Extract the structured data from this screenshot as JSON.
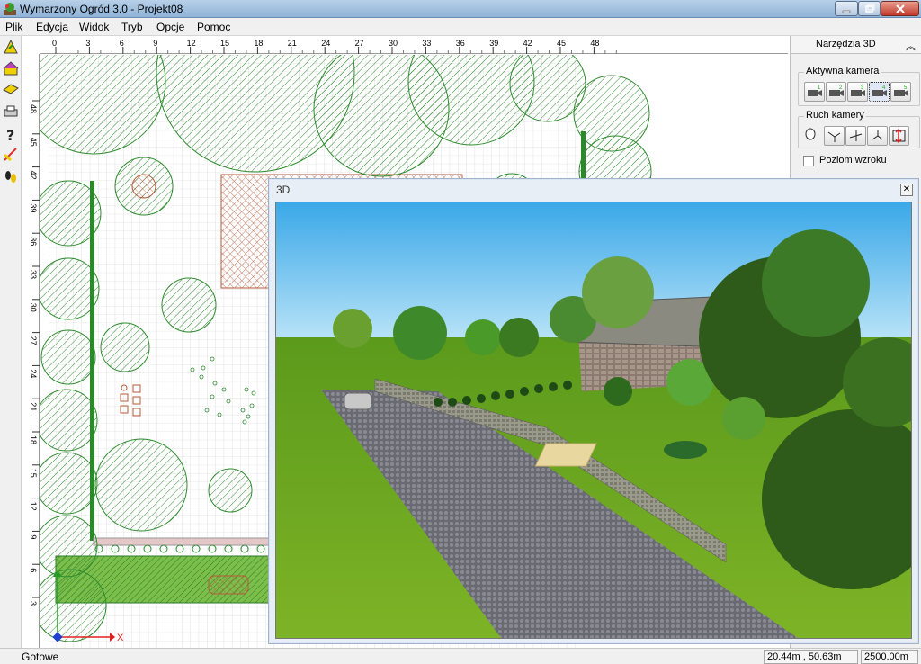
{
  "window": {
    "title": "Wymarzony Ogród 3.0 - Projekt08"
  },
  "menu": [
    "Plik",
    "Edycja",
    "Widok",
    "Tryb",
    "Opcje",
    "Pomoc"
  ],
  "ruler": {
    "top_ticks": [
      "0",
      "3",
      "6",
      "9",
      "12",
      "15",
      "18",
      "21",
      "24",
      "27",
      "30",
      "33",
      "36",
      "39",
      "42",
      "45",
      "48"
    ],
    "left_ticks": [
      "48",
      "45",
      "42",
      "39",
      "36",
      "33",
      "30",
      "27",
      "24",
      "21",
      "18",
      "15",
      "12",
      "9",
      "6",
      "3"
    ]
  },
  "axes": {
    "x": "X",
    "y": "Y"
  },
  "panel": {
    "title": "Narzędzia 3D",
    "camera_group": "Aktywna kamera",
    "camera_buttons": [
      "1",
      "2",
      "3",
      "4",
      "5"
    ],
    "movement_group": "Ruch kamery",
    "eye_level_label": "Poziom wzroku"
  },
  "view3d": {
    "title": "3D"
  },
  "status": {
    "text": "Gotowe",
    "coords": "20.44m , 50.63m",
    "scale": "2500.00m"
  },
  "colors": {
    "accent": "#1a7a1a",
    "grid": "#d0d0d0",
    "hatch": "#2e8b2e",
    "brick": "#b35a3a"
  }
}
